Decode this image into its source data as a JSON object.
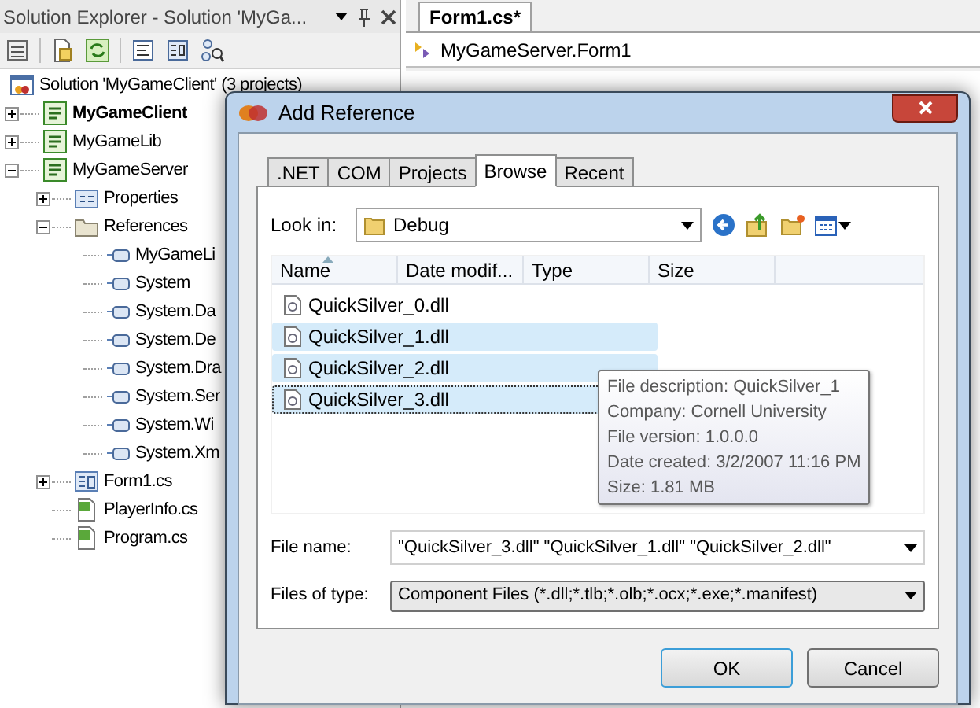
{
  "explorer": {
    "title": "Solution Explorer - Solution 'MyGa...",
    "tree": [
      {
        "label": "Solution 'MyGameClient' (3 projects)",
        "kind": "solution",
        "children": [
          {
            "label": "MyGameClient",
            "kind": "project",
            "startup": true,
            "expanded": false
          },
          {
            "label": "MyGameLib",
            "kind": "project",
            "startup": false,
            "expanded": false
          },
          {
            "label": "MyGameServer",
            "kind": "project",
            "startup": false,
            "expanded": true,
            "children": [
              {
                "label": "Properties",
                "kind": "properties",
                "expanded": false
              },
              {
                "label": "References",
                "kind": "folder",
                "expanded": true,
                "children": [
                  {
                    "label": "MyGameLi",
                    "kind": "reference"
                  },
                  {
                    "label": "System",
                    "kind": "reference"
                  },
                  {
                    "label": "System.Da",
                    "kind": "reference"
                  },
                  {
                    "label": "System.De",
                    "kind": "reference"
                  },
                  {
                    "label": "System.Dra",
                    "kind": "reference"
                  },
                  {
                    "label": "System.Ser",
                    "kind": "reference"
                  },
                  {
                    "label": "System.Wi",
                    "kind": "reference"
                  },
                  {
                    "label": "System.Xm",
                    "kind": "reference"
                  }
                ]
              },
              {
                "label": "Form1.cs",
                "kind": "form",
                "expanded": false
              },
              {
                "label": "PlayerInfo.cs",
                "kind": "code"
              },
              {
                "label": "Program.cs",
                "kind": "code"
              }
            ]
          }
        ]
      }
    ]
  },
  "editor": {
    "tab": "Form1.cs*",
    "navigation": "MyGameServer.Form1"
  },
  "dialog": {
    "title": "Add Reference",
    "tabs": [
      {
        "label": ".NET",
        "selected": false
      },
      {
        "label": "COM",
        "selected": false
      },
      {
        "label": "Projects",
        "selected": false
      },
      {
        "label": "Browse",
        "selected": true
      },
      {
        "label": "Recent",
        "selected": false
      }
    ],
    "look_in": {
      "label": "Look in:",
      "value": "Debug"
    },
    "columns": [
      {
        "label": "Name",
        "sorted": true
      },
      {
        "label": "Date modif...",
        "sorted": false
      },
      {
        "label": "Type",
        "sorted": false
      },
      {
        "label": "Size",
        "sorted": false
      }
    ],
    "files": [
      {
        "name": "QuickSilver_0.dll",
        "selected": false,
        "focused": false
      },
      {
        "name": "QuickSilver_1.dll",
        "selected": true,
        "focused": false
      },
      {
        "name": "QuickSilver_2.dll",
        "selected": true,
        "focused": false
      },
      {
        "name": "QuickSilver_3.dll",
        "selected": true,
        "focused": true
      }
    ],
    "tooltip": [
      "File description: QuickSilver_1",
      "Company: Cornell University",
      "File version: 1.0.0.0",
      "Date created: 3/2/2007 11:16 PM",
      "Size: 1.81 MB"
    ],
    "file_name": {
      "label": "File name:",
      "value": "\"QuickSilver_3.dll\" \"QuickSilver_1.dll\" \"QuickSilver_2.dll\""
    },
    "file_type": {
      "label": "Files of type:",
      "value": "Component Files (*.dll;*.tlb;*.olb;*.ocx;*.exe;*.manifest)"
    },
    "buttons": [
      "OK",
      "Cancel"
    ]
  }
}
